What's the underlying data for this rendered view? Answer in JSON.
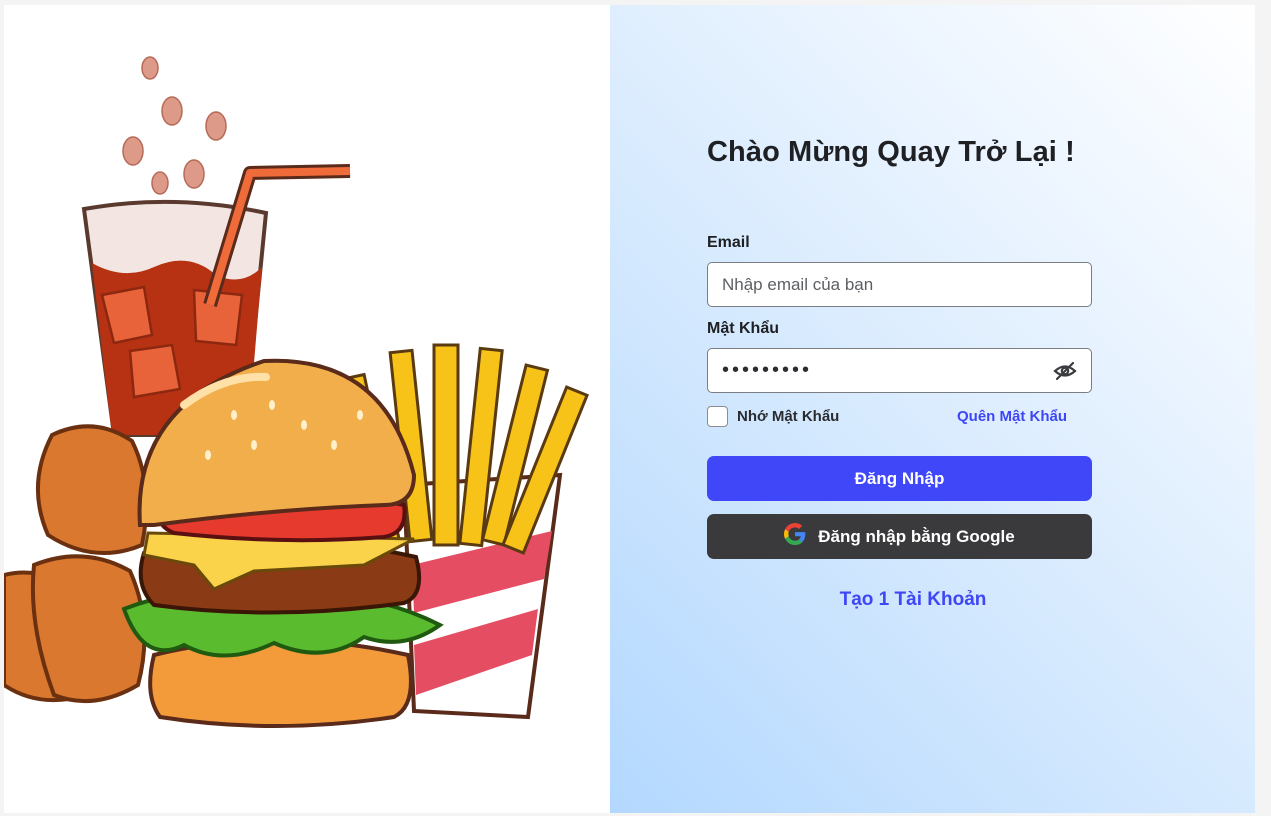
{
  "login": {
    "title": "Chào Mừng Quay Trở Lại !",
    "email_label": "Email",
    "email_placeholder": "Nhập email của bạn",
    "password_label": "Mật Khẩu",
    "password_value": "•••••••••",
    "remember_label": "Nhớ Mật Khẩu",
    "forgot_label": "Quên Mật Khẩu",
    "login_button": "Đăng Nhập",
    "google_button": "Đăng nhập bằng Google",
    "create_account": "Tạo 1 Tài Khoản"
  },
  "icons": {
    "password_toggle": "eye-off-icon",
    "google": "google-icon",
    "illustration": "fast-food-illustration"
  },
  "colors": {
    "accent": "#3f47f9",
    "google_button_bg": "#3a3a3c",
    "text_dark": "#1f2023",
    "panel_gradient_start": "#b3d8ff",
    "panel_gradient_end": "#ffffff"
  }
}
